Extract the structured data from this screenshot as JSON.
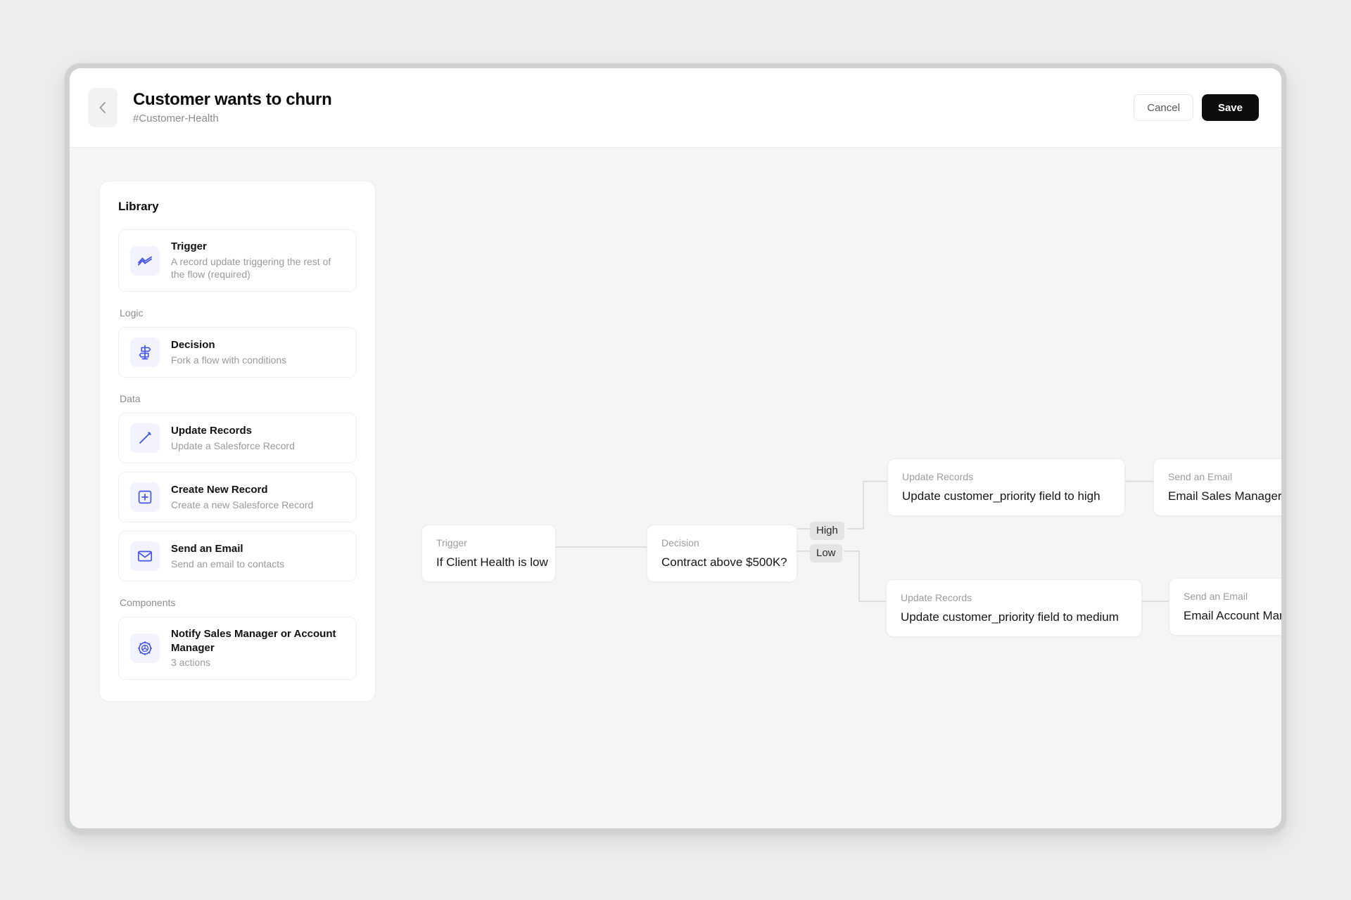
{
  "header": {
    "back_icon": "chevron-left-icon",
    "title": "Customer wants to churn",
    "subtitle": "#Customer-Health",
    "cancel_label": "Cancel",
    "save_label": "Save"
  },
  "library": {
    "heading": "Library",
    "groups": [
      {
        "label": "",
        "items": [
          {
            "icon": "activity-zigzag-icon",
            "title": "Trigger",
            "desc": "A record update triggering the rest of the flow (required)"
          }
        ]
      },
      {
        "label": "Logic",
        "items": [
          {
            "icon": "signpost-icon",
            "title": "Decision",
            "desc": "Fork a flow with conditions"
          }
        ]
      },
      {
        "label": "Data",
        "items": [
          {
            "icon": "pencil-icon",
            "title": "Update Records",
            "desc": "Update a Salesforce Record"
          },
          {
            "icon": "plus-square-icon",
            "title": "Create New Record",
            "desc": "Create a new Salesforce Record"
          },
          {
            "icon": "envelope-icon",
            "title": "Send an Email",
            "desc": "Send an email to contacts"
          }
        ]
      },
      {
        "label": "Components",
        "items": [
          {
            "icon": "gear-icon",
            "title": "Notify Sales Manager or Account Manager",
            "desc": "3 actions"
          }
        ]
      }
    ]
  },
  "flow": {
    "nodes": [
      {
        "id": "trigger",
        "kind": "Trigger",
        "title": "If Client Health is low"
      },
      {
        "id": "decision",
        "kind": "Decision",
        "title": "Contract above $500K?"
      },
      {
        "id": "update_high",
        "kind": "Update Records",
        "title": "Update customer_priority field to high"
      },
      {
        "id": "email_sales",
        "kind": "Send an Email",
        "title": "Email Sales Manager"
      },
      {
        "id": "update_low",
        "kind": "Update Records",
        "title": "Update customer_priority field to medium"
      },
      {
        "id": "email_account",
        "kind": "Send an Email",
        "title": "Email Account Manager"
      }
    ],
    "branches": [
      {
        "id": "high",
        "label": "High"
      },
      {
        "id": "low",
        "label": "Low"
      }
    ]
  },
  "colors": {
    "accent": "#4455e8",
    "icon_tile": "#f3f3fd",
    "canvas": "#f5f5f5",
    "save_button": "#0d0d0d",
    "branch_chip": "#e4e4e4",
    "connector": "#d8d8d8"
  }
}
